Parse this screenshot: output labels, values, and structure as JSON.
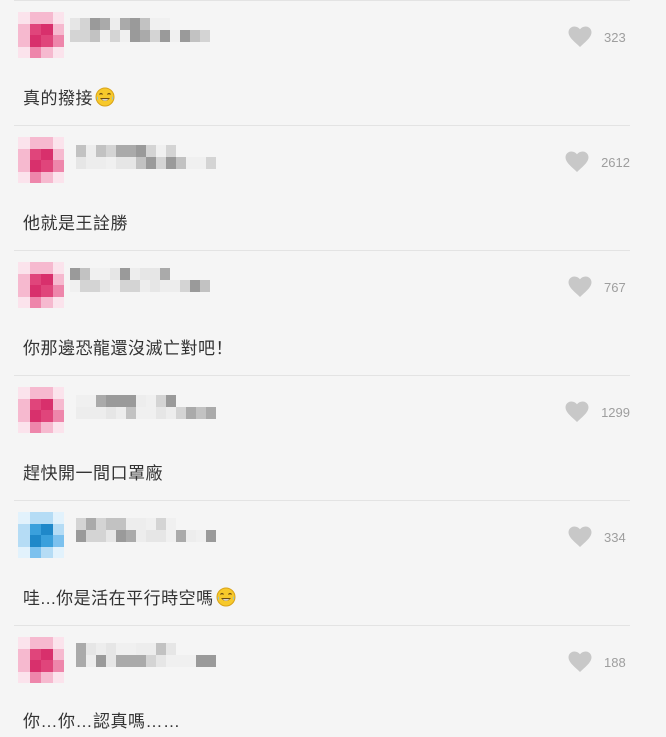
{
  "comments": [
    {
      "likes": "323",
      "text": "真的撥接",
      "emoji": "tears-of-joy-emoji",
      "avatar_color": "pink"
    },
    {
      "likes": "2612",
      "text": "他就是王詮勝",
      "emoji": null,
      "avatar_color": "pink"
    },
    {
      "likes": "767",
      "text": "你那邊恐龍還沒滅亡對吧！",
      "emoji": null,
      "avatar_color": "pink"
    },
    {
      "likes": "1299",
      "text": "趕快開一間口罩廠",
      "emoji": null,
      "avatar_color": "pink"
    },
    {
      "likes": "334",
      "text": "哇...你是活在平行時空嗎",
      "emoji": "tears-of-joy-emoji",
      "avatar_color": "blue"
    },
    {
      "likes": "188",
      "text": "你…你…認真嗎……",
      "emoji": null,
      "avatar_color": "pink"
    }
  ],
  "colors": {
    "background": "#f5f5f5",
    "divider": "#e3e3e3",
    "heart": "#c8c8c8",
    "count": "#9e9e9e",
    "text": "#333333",
    "avatar_pink": "#e0457b",
    "avatar_blue": "#3aa0dc"
  }
}
